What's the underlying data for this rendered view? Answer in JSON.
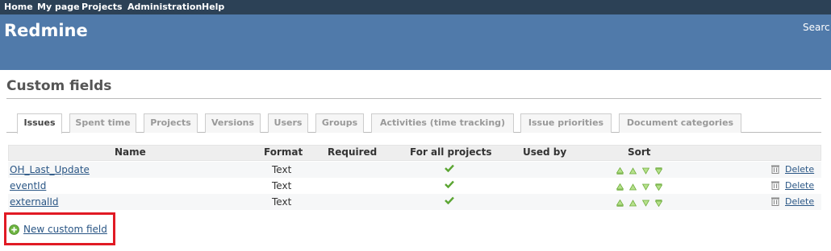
{
  "top_menu": [
    "Home",
    "My page",
    "Projects",
    "Administration",
    "Help"
  ],
  "header": {
    "title": "Redmine",
    "search_label": "Searc"
  },
  "page": {
    "title": "Custom fields"
  },
  "tabs": [
    {
      "label": "Issues",
      "selected": true
    },
    {
      "label": "Spent time",
      "selected": false
    },
    {
      "label": "Projects",
      "selected": false
    },
    {
      "label": "Versions",
      "selected": false
    },
    {
      "label": "Users",
      "selected": false
    },
    {
      "label": "Groups",
      "selected": false
    },
    {
      "label": "Activities (time tracking)",
      "selected": false
    },
    {
      "label": "Issue priorities",
      "selected": false
    },
    {
      "label": "Document categories",
      "selected": false
    }
  ],
  "table": {
    "headers": [
      "Name",
      "Format",
      "Required",
      "For all projects",
      "Used by",
      "Sort"
    ],
    "rows": [
      {
        "name": "OH_Last_Update",
        "format": "Text",
        "required": false,
        "for_all_projects": true,
        "used_by": "",
        "delete_label": "Delete"
      },
      {
        "name": "eventId",
        "format": "Text",
        "required": false,
        "for_all_projects": true,
        "used_by": "",
        "delete_label": "Delete"
      },
      {
        "name": "externalId",
        "format": "Text",
        "required": false,
        "for_all_projects": true,
        "used_by": "",
        "delete_label": "Delete"
      }
    ]
  },
  "actions": {
    "new_custom_field": "New custom field"
  },
  "colors": {
    "top_menu_bg": "#2c4156",
    "header_bg": "#507aaa",
    "link": "#2a5685",
    "check": "#5ba532",
    "highlight": "#e11a24"
  }
}
